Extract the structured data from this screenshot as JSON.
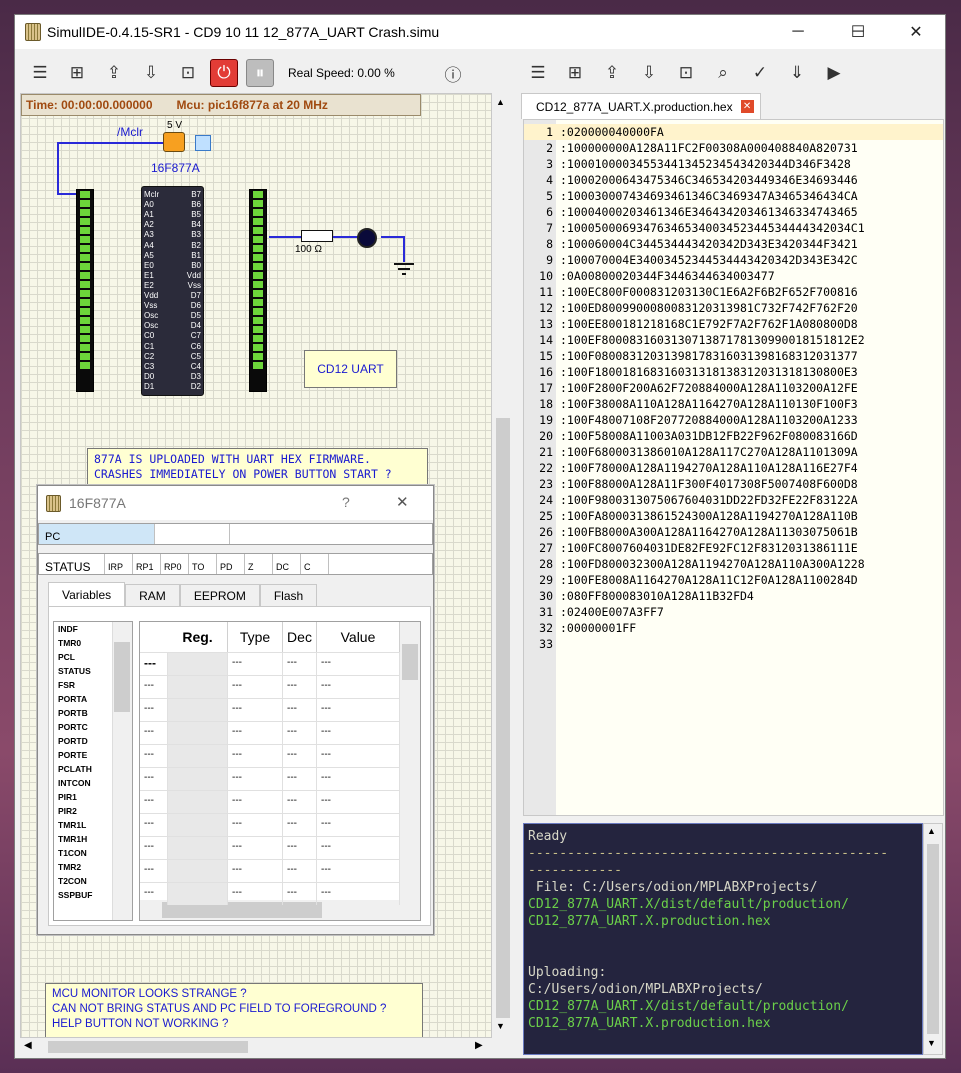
{
  "window": {
    "title": "SimulIDE-0.4.15-SR1  -  CD9 10 11 12_877A_UART Crash.simu",
    "min_glyph": "─",
    "max_glyph": "☐",
    "close_glyph": "✕"
  },
  "toolbar": {
    "real_speed": "Real Speed: 0.00 %"
  },
  "circuit": {
    "time_label": "Time: 00:00:00.000000",
    "mcu_label": "Mcu: pic16f877a at 20 MHz",
    "mclr_label": "/Mclr",
    "voltage_label": "5 V",
    "chip_name": "16F877A",
    "resistor_label": "100 Ω",
    "uart_box": "CD12  UART",
    "left_pins": [
      "Mclr",
      "A0",
      "A1",
      "A2",
      "A3",
      "A4",
      "A5",
      "E0",
      "E1",
      "E2",
      "Vdd",
      "Vss",
      "Osc",
      "Osc",
      "C0",
      "C1",
      "C2",
      "C3",
      "D0",
      "D1"
    ],
    "right_pins": [
      "B7",
      "B6",
      "B5",
      "B4",
      "B3",
      "B2",
      "B1",
      "B0",
      "Vdd",
      "Vss",
      "D7",
      "D6",
      "D5",
      "D4",
      "C7",
      "C6",
      "C5",
      "C4",
      "D3",
      "D2"
    ],
    "note1": "877A IS UPLOADED WITH UART HEX FIRMWARE.\nCRASHES IMMEDIATELY ON POWER BUTTON START ?",
    "note2": "MCU MONITOR LOOKS STRANGE ?\nCAN NOT BRING STATUS AND PC FIELD TO FOREGROUND ?\nHELP BUTTON NOT WORKING ?"
  },
  "monitor": {
    "title": "16F877A",
    "help": "?",
    "close": "✕",
    "pc_label": "PC",
    "status_label": "STATUS",
    "status_bits": [
      "IRP",
      "RP1",
      "RP0",
      "TO",
      "PD",
      "Z",
      "DC",
      "C"
    ],
    "tabs": [
      "Variables",
      "RAM",
      "EEPROM",
      "Flash"
    ],
    "variables": [
      "INDF",
      "TMR0",
      "PCL",
      "STATUS",
      "FSR",
      "PORTA",
      "PORTB",
      "PORTC",
      "PORTD",
      "PORTE",
      "PCLATH",
      "INTCON",
      "PIR1",
      "PIR2",
      "TMR1L",
      "TMR1H",
      "T1CON",
      "TMR2",
      "T2CON",
      "SSPBUF"
    ],
    "table_headers": [
      "Reg.",
      "Type",
      "Dec",
      "Value"
    ],
    "empty": "---",
    "first_dash": "---"
  },
  "editor": {
    "tab_label": "CD12_877A_UART.X.production.hex",
    "lines": [
      ":020000040000FA",
      ":100000000A128A11FC2F00308A000408840A820731",
      ":10001000034553441345234543420344D346F3428",
      ":10002000643475346C346534203449346E34693446",
      ":10003000743469346134 6C3469347A3465346434CA",
      ":100040002034613 46E3464342034613463347434 65",
      ":10005000693476346534003452344534444342034C1",
      ":100060004C344534443420342D343E3420344F3421",
      ":100070004E3400345234453444342034 2D343E342C",
      ":0A00800020344F344634463400 3477",
      ":100EC800F000831203130C1E6A2F6B2F652F700816",
      ":100ED800990008 0083120313981C732F742F762F20",
      ":100EE800181218 168C1E792F7A2F762F1A080800D8",
      ":100EF8000831603130713871781309900181518 12E2",
      ":100F0800831203139817831603139816831203137 7",
      ":100F1800181683160313181383120313181308 00E3",
      ":100F2800F200A62F720884000A128A1103200A12FE",
      ":100F38008A110A128A1164270A128A110130F100F3",
      ":100F48007108F207720884000A128A1103200A1233",
      ":100F58008A11003A031DB12FB22F962F080083166D",
      ":100F6800031386010A128A117C270A128A1101309A",
      ":100F78000A128A1194270A128A110A128A116E27F4",
      ":100F88000A128A11F300F4017308F5007408F600D8",
      ":100F980031307506760 4031DD22FD32FE22F83122A",
      ":100FA80003138615 24300A128A1194270A128A110B",
      ":100FB8000A300A128A1164270A128A11303075061B",
      ":100FC8007604031DE82FE92FC12F8312031386111E",
      ":100FD80003 2300A128A1194270A128A110A300A1228",
      ":100FE8008A1164270A128A11C12F0A128A1100284D",
      ":080FF80008 3010A128A11B32FD4",
      ":02400E007A3FF7",
      ":00000001FF",
      ""
    ]
  },
  "console": {
    "lines": [
      {
        "t": "Ready",
        "c": "w"
      },
      {
        "t": "----------------------------------------------",
        "c": "y"
      },
      {
        "t": "------------",
        "c": "y"
      },
      {
        "t": " File: C:/Users/odion/MPLABXProjects/",
        "c": "w"
      },
      {
        "t": "CD12_877A_UART.X/dist/default/production/",
        "c": "g"
      },
      {
        "t": "CD12_877A_UART.X.production.hex",
        "c": "g"
      },
      {
        "t": "",
        "c": "w"
      },
      {
        "t": "",
        "c": "w"
      },
      {
        "t": "Uploading:",
        "c": "w"
      },
      {
        "t": "C:/Users/odion/MPLABXProjects/",
        "c": "w"
      },
      {
        "t": "CD12_877A_UART.X/dist/default/production/",
        "c": "g"
      },
      {
        "t": "CD12_877A_UART.X.production.hex",
        "c": "g"
      }
    ]
  }
}
